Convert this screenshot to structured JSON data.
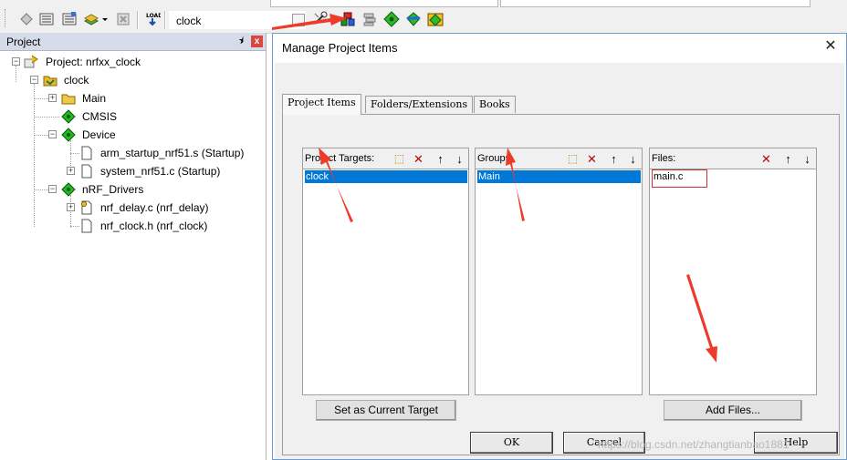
{
  "toolbar": {
    "target_value": "clock"
  },
  "project_panel": {
    "title": "Project",
    "pin_glyph": "⯨",
    "close_glyph": "x",
    "tree": {
      "root": "Project: nrfxx_clock",
      "target": "clock",
      "groups": [
        {
          "label": "Main"
        },
        {
          "label": "CMSIS"
        },
        {
          "label": "Device",
          "files": [
            "arm_startup_nrf51.s (Startup)",
            "system_nrf51.c (Startup)"
          ]
        },
        {
          "label": "nRF_Drivers",
          "files": [
            "nrf_delay.c (nrf_delay)",
            "nrf_clock.h (nrf_clock)"
          ]
        }
      ]
    }
  },
  "dialog": {
    "title": "Manage Project Items",
    "close_glyph": "✕",
    "tabs": [
      "Project Items",
      "Folders/Extensions",
      "Books"
    ],
    "targets": {
      "caption": "Project Targets:",
      "items": [
        "clock"
      ],
      "button": "Set as Current Target"
    },
    "groups": {
      "caption": "Groups:",
      "items": [
        "Main"
      ]
    },
    "files": {
      "caption": "Files:",
      "items": [
        "main.c"
      ],
      "button": "Add Files..."
    },
    "list_buttons": {
      "new": "⬚",
      "delete": "✕",
      "up": "↑",
      "down": "↓"
    },
    "ok": "OK",
    "cancel": "Cancel",
    "help": "Help"
  },
  "watermark": "https://blog.csdn.net/zhangtianbao1881",
  "colors": {
    "selection": "#0078d7",
    "arrow": "#ec3b2b",
    "panel_header": "#d6dbe9"
  }
}
